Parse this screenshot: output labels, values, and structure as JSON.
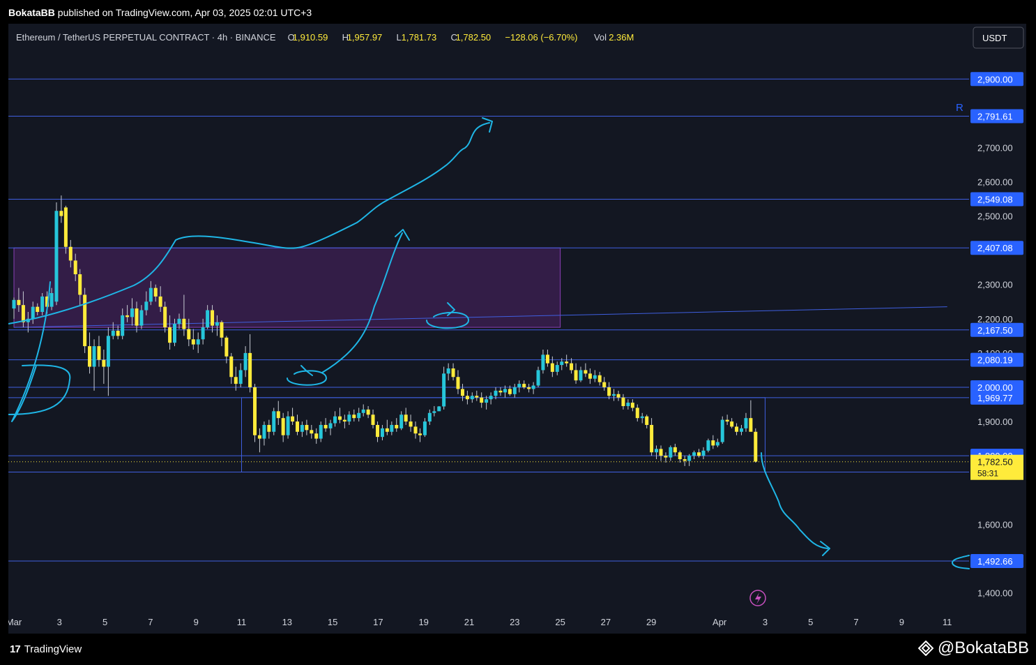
{
  "publish_bar": {
    "author": "BokataBB",
    "text": "published on TradingView.com, Apr 03, 2025 02:01 UTC+3"
  },
  "footer": {
    "logo_text": "TradingView",
    "watermark": "@BokataBB"
  },
  "colors": {
    "background": "#131722",
    "up": "#26c6da",
    "down": "#ffeb3b",
    "level_line": "#3f5fe0",
    "drawing": "#1fb6e6",
    "zone_fill": "#3a1f4d",
    "zone_stroke": "#8a3fb4",
    "label_bg": "#2962ff"
  },
  "chart_data": {
    "type": "candlestick",
    "legend": {
      "symbol": "Ethereum / TetherUS PERPETUAL CONTRACT · 4h · BINANCE",
      "open_label": "O",
      "open": "1,910.59",
      "high_label": "H",
      "high": "1,957.97",
      "low_label": "L",
      "low": "1,781.73",
      "close_label": "C",
      "close": "1,782.50",
      "change": "−128.06 (−6.70%)",
      "vol_label": "Vol",
      "vol": "2.36M"
    },
    "currency_button": "USDT",
    "right_marker": "R",
    "ylim": [
      1350,
      2980
    ],
    "x_day_range": [
      1,
      42
    ],
    "x_ticks": [
      {
        "day": 1,
        "label": "Mar"
      },
      {
        "day": 3,
        "label": "3"
      },
      {
        "day": 5,
        "label": "5"
      },
      {
        "day": 7,
        "label": "7"
      },
      {
        "day": 9,
        "label": "9"
      },
      {
        "day": 11,
        "label": "11"
      },
      {
        "day": 13,
        "label": "13"
      },
      {
        "day": 15,
        "label": "15"
      },
      {
        "day": 17,
        "label": "17"
      },
      {
        "day": 19,
        "label": "19"
      },
      {
        "day": 21,
        "label": "21"
      },
      {
        "day": 23,
        "label": "23"
      },
      {
        "day": 25,
        "label": "25"
      },
      {
        "day": 27,
        "label": "27"
      },
      {
        "day": 29,
        "label": "29"
      },
      {
        "day": 32,
        "label": "Apr"
      },
      {
        "day": 34,
        "label": "3"
      },
      {
        "day": 36,
        "label": "5"
      },
      {
        "day": 38,
        "label": "7"
      },
      {
        "day": 40,
        "label": "9"
      },
      {
        "day": 42,
        "label": "11"
      }
    ],
    "y_ticks": [
      {
        "value": 2700,
        "label": "2,700.00"
      },
      {
        "value": 2600,
        "label": "2,600.00"
      },
      {
        "value": 2500,
        "label": "2,500.00"
      },
      {
        "value": 2300,
        "label": "2,300.00"
      },
      {
        "value": 2200,
        "label": "2,200.00"
      },
      {
        "value": 2100,
        "label": "2,100.00"
      },
      {
        "value": 1900,
        "label": "1,900.00"
      },
      {
        "value": 1600,
        "label": "1,600.00"
      },
      {
        "value": 1400,
        "label": "1,400.00"
      }
    ],
    "levels": [
      {
        "value": 2900,
        "label": "2,900.00"
      },
      {
        "value": 2791.61,
        "label": "2,791.61"
      },
      {
        "value": 2549.08,
        "label": "2,549.08"
      },
      {
        "value": 2407.08,
        "label": "2,407.08"
      },
      {
        "value": 2167.5,
        "label": "2,167.50"
      },
      {
        "value": 2080.19,
        "label": "2,080.19"
      },
      {
        "value": 2000,
        "label": "2,000.00"
      },
      {
        "value": 1969.77,
        "label": "1,969.77"
      },
      {
        "value": 1800,
        "label": "1,800.00"
      },
      {
        "value": 1752.5,
        "label": "1,752.50"
      },
      {
        "value": 1492.66,
        "label": "1,492.66"
      }
    ],
    "current_price": {
      "value": 1782.5,
      "label": "1,782.50",
      "countdown": "58:31"
    },
    "zone": {
      "day_start": 1,
      "day_end": 25,
      "price_low": 2175,
      "price_high": 2407
    },
    "range_box": {
      "day_start": 11,
      "day_end": 34,
      "price_low": 1752.5,
      "price_high": 1969.77
    },
    "trendline": {
      "day_start": 1,
      "price_start": 2175,
      "day_end": 42,
      "price_end": 2235
    },
    "candles": [
      [
        1.0,
        2230,
        2262,
        2200,
        2255
      ],
      [
        1.17,
        2255,
        2290,
        2220,
        2240
      ],
      [
        1.33,
        2240,
        2280,
        2175,
        2190
      ],
      [
        1.5,
        2190,
        2220,
        2160,
        2200
      ],
      [
        1.67,
        2200,
        2250,
        2185,
        2235
      ],
      [
        1.83,
        2235,
        2245,
        2210,
        2220
      ],
      [
        2.0,
        2220,
        2275,
        2210,
        2265
      ],
      [
        2.17,
        2265,
        2280,
        2215,
        2235
      ],
      [
        2.33,
        2235,
        2290,
        2225,
        2275
      ],
      [
        2.5,
        2250,
        2540,
        2240,
        2515
      ],
      [
        2.67,
        2515,
        2560,
        2480,
        2500
      ],
      [
        2.83,
        2525,
        2530,
        2390,
        2410
      ],
      [
        3.0,
        2410,
        2430,
        2350,
        2370
      ],
      [
        3.17,
        2370,
        2390,
        2310,
        2330
      ],
      [
        3.33,
        2330,
        2345,
        2240,
        2270
      ],
      [
        3.5,
        2270,
        2290,
        2100,
        2120
      ],
      [
        3.67,
        2120,
        2160,
        2040,
        2060
      ],
      [
        3.83,
        2060,
        2140,
        1990,
        2120
      ],
      [
        4.0,
        2120,
        2150,
        2060,
        2080
      ],
      [
        4.17,
        2080,
        2110,
        2010,
        2060
      ],
      [
        4.33,
        2060,
        2175,
        1975,
        2150
      ],
      [
        4.5,
        2150,
        2190,
        2140,
        2165
      ],
      [
        4.67,
        2165,
        2180,
        2140,
        2150
      ],
      [
        4.83,
        2150,
        2230,
        2140,
        2210
      ],
      [
        5.0,
        2210,
        2240,
        2190,
        2205
      ],
      [
        5.17,
        2205,
        2260,
        2180,
        2230
      ],
      [
        5.33,
        2230,
        2250,
        2160,
        2180
      ],
      [
        5.5,
        2180,
        2240,
        2170,
        2225
      ],
      [
        5.67,
        2225,
        2280,
        2210,
        2250
      ],
      [
        5.83,
        2250,
        2310,
        2240,
        2290
      ],
      [
        6.0,
        2290,
        2300,
        2250,
        2265
      ],
      [
        6.17,
        2265,
        2295,
        2220,
        2235
      ],
      [
        6.33,
        2235,
        2250,
        2160,
        2175
      ],
      [
        6.5,
        2175,
        2210,
        2110,
        2130
      ],
      [
        6.67,
        2130,
        2200,
        2120,
        2185
      ],
      [
        6.83,
        2185,
        2215,
        2170,
        2200
      ],
      [
        7.0,
        2200,
        2270,
        2150,
        2170
      ],
      [
        7.17,
        2170,
        2200,
        2120,
        2140
      ],
      [
        7.33,
        2140,
        2170,
        2110,
        2125
      ],
      [
        7.5,
        2125,
        2160,
        2100,
        2140
      ],
      [
        7.67,
        2140,
        2200,
        2125,
        2175
      ],
      [
        7.83,
        2175,
        2240,
        2170,
        2225
      ],
      [
        8.0,
        2225,
        2240,
        2160,
        2180
      ],
      [
        8.17,
        2180,
        2210,
        2150,
        2190
      ],
      [
        8.33,
        2190,
        2195,
        2120,
        2145
      ],
      [
        8.5,
        2145,
        2150,
        2070,
        2090
      ],
      [
        8.67,
        2090,
        2100,
        2010,
        2030
      ],
      [
        8.83,
        2030,
        2060,
        1990,
        2010
      ],
      [
        9.0,
        2010,
        2070,
        2000,
        2050
      ],
      [
        9.17,
        2050,
        2120,
        2030,
        2100
      ],
      [
        9.33,
        2100,
        2155,
        1985,
        2000
      ],
      [
        9.5,
        2000,
        2010,
        1840,
        1860
      ],
      [
        9.67,
        1860,
        1880,
        1810,
        1850
      ],
      [
        9.83,
        1850,
        1900,
        1830,
        1890
      ],
      [
        10.0,
        1890,
        1905,
        1850,
        1870
      ],
      [
        10.17,
        1870,
        1940,
        1860,
        1930
      ],
      [
        10.33,
        1930,
        1960,
        1890,
        1910
      ],
      [
        10.5,
        1910,
        1925,
        1840,
        1860
      ],
      [
        10.67,
        1860,
        1930,
        1850,
        1915
      ],
      [
        10.83,
        1915,
        1940,
        1890,
        1900
      ],
      [
        11.0,
        1900,
        1920,
        1860,
        1870
      ],
      [
        11.17,
        1870,
        1900,
        1855,
        1890
      ],
      [
        11.33,
        1890,
        1905,
        1860,
        1875
      ],
      [
        11.5,
        1875,
        1890,
        1850,
        1865
      ],
      [
        11.67,
        1865,
        1880,
        1835,
        1850
      ],
      [
        11.83,
        1850,
        1900,
        1840,
        1890
      ],
      [
        12.0,
        1890,
        1910,
        1870,
        1880
      ],
      [
        12.17,
        1880,
        1905,
        1860,
        1895
      ],
      [
        12.33,
        1895,
        1930,
        1885,
        1915
      ],
      [
        12.5,
        1915,
        1940,
        1895,
        1905
      ],
      [
        12.67,
        1905,
        1920,
        1880,
        1900
      ],
      [
        12.83,
        1900,
        1930,
        1890,
        1920
      ],
      [
        13.0,
        1920,
        1935,
        1900,
        1910
      ],
      [
        13.17,
        1910,
        1940,
        1900,
        1925
      ],
      [
        13.33,
        1925,
        1950,
        1915,
        1935
      ],
      [
        13.5,
        1935,
        1945,
        1910,
        1920
      ],
      [
        13.67,
        1920,
        1935,
        1880,
        1890
      ],
      [
        13.83,
        1890,
        1900,
        1840,
        1855
      ],
      [
        14.0,
        1855,
        1890,
        1845,
        1880
      ],
      [
        14.17,
        1880,
        1905,
        1860,
        1870
      ],
      [
        14.33,
        1870,
        1900,
        1860,
        1890
      ],
      [
        14.5,
        1890,
        1910,
        1870,
        1880
      ],
      [
        14.67,
        1880,
        1930,
        1875,
        1920
      ],
      [
        14.83,
        1920,
        1940,
        1890,
        1900
      ],
      [
        15.0,
        1900,
        1920,
        1870,
        1885
      ],
      [
        15.17,
        1885,
        1900,
        1850,
        1865
      ],
      [
        15.33,
        1865,
        1880,
        1840,
        1860
      ],
      [
        15.5,
        1860,
        1910,
        1855,
        1900
      ],
      [
        15.67,
        1900,
        1935,
        1890,
        1925
      ],
      [
        15.83,
        1925,
        1945,
        1915,
        1930
      ],
      [
        16.0,
        1930,
        1945,
        1940,
        1944
      ],
      [
        16.17,
        1944,
        2060,
        1935,
        2040
      ],
      [
        16.33,
        2040,
        2070,
        2020,
        2055
      ],
      [
        16.5,
        2055,
        2070,
        2020,
        2030
      ],
      [
        16.67,
        2030,
        2050,
        1980,
        1995
      ],
      [
        16.83,
        1995,
        2010,
        1960,
        1975
      ],
      [
        17.0,
        1975,
        1990,
        1950,
        1965
      ],
      [
        17.17,
        1965,
        1985,
        1955,
        1975
      ],
      [
        17.33,
        1975,
        1990,
        1960,
        1970
      ],
      [
        17.5,
        1970,
        1985,
        1940,
        1955
      ],
      [
        17.67,
        1955,
        1975,
        1935,
        1965
      ],
      [
        17.83,
        1965,
        1985,
        1950,
        1975
      ],
      [
        18.0,
        1975,
        2000,
        1965,
        1990
      ],
      [
        18.17,
        1990,
        2000,
        1975,
        1985
      ],
      [
        18.33,
        1985,
        2005,
        1970,
        1995
      ],
      [
        18.5,
        1995,
        2005,
        1975,
        1980
      ],
      [
        18.67,
        1980,
        2010,
        1970,
        2000
      ],
      [
        18.83,
        2000,
        2020,
        1985,
        2010
      ],
      [
        19.0,
        2010,
        2020,
        1995,
        2000
      ],
      [
        19.17,
        2000,
        2010,
        1985,
        1995
      ],
      [
        19.33,
        1995,
        2015,
        1980,
        2005
      ],
      [
        19.5,
        2005,
        2060,
        2000,
        2050
      ],
      [
        19.67,
        2050,
        2110,
        2040,
        2095
      ],
      [
        19.83,
        2095,
        2110,
        2060,
        2070
      ],
      [
        20.0,
        2070,
        2090,
        2030,
        2045
      ],
      [
        20.17,
        2045,
        2075,
        2035,
        2065
      ],
      [
        20.33,
        2065,
        2085,
        2050,
        2075
      ],
      [
        20.5,
        2075,
        2095,
        2060,
        2070
      ],
      [
        20.67,
        2070,
        2085,
        2040,
        2050
      ],
      [
        20.83,
        2050,
        2070,
        2010,
        2020
      ],
      [
        21.0,
        2020,
        2060,
        2015,
        2050
      ],
      [
        21.17,
        2050,
        2070,
        2030,
        2040
      ],
      [
        21.33,
        2040,
        2055,
        2010,
        2025
      ],
      [
        21.5,
        2025,
        2050,
        2015,
        2035
      ],
      [
        21.67,
        2035,
        2045,
        2005,
        2015
      ],
      [
        21.83,
        2015,
        2030,
        1990,
        2000
      ],
      [
        22.0,
        2000,
        2015,
        1965,
        1975
      ],
      [
        22.17,
        1975,
        1995,
        1960,
        1980
      ],
      [
        22.33,
        1980,
        1990,
        1960,
        1970
      ],
      [
        22.5,
        1970,
        1980,
        1935,
        1945
      ],
      [
        22.67,
        1945,
        1965,
        1935,
        1955
      ],
      [
        22.83,
        1955,
        1965,
        1930,
        1940
      ],
      [
        23.0,
        1940,
        1950,
        1900,
        1910
      ],
      [
        23.17,
        1910,
        1925,
        1895,
        1915
      ],
      [
        23.33,
        1915,
        1920,
        1880,
        1890
      ],
      [
        23.5,
        1890,
        1910,
        1800,
        1810
      ],
      [
        23.67,
        1810,
        1830,
        1790,
        1820
      ],
      [
        23.83,
        1820,
        1830,
        1785,
        1800
      ],
      [
        24.0,
        1800,
        1810,
        1780,
        1795
      ],
      [
        24.17,
        1795,
        1830,
        1785,
        1825
      ],
      [
        24.33,
        1825,
        1835,
        1800,
        1810
      ],
      [
        24.5,
        1810,
        1815,
        1780,
        1790
      ],
      [
        24.67,
        1790,
        1800,
        1770,
        1785
      ],
      [
        24.83,
        1785,
        1805,
        1770,
        1800
      ],
      [
        25.0,
        1800,
        1815,
        1790,
        1810
      ],
      [
        25.17,
        1810,
        1820,
        1795,
        1800
      ],
      [
        25.33,
        1800,
        1825,
        1790,
        1815
      ],
      [
        25.5,
        1815,
        1850,
        1810,
        1845
      ],
      [
        25.67,
        1845,
        1860,
        1820,
        1830
      ],
      [
        25.83,
        1830,
        1850,
        1825,
        1840
      ],
      [
        26.0,
        1840,
        1915,
        1835,
        1905
      ],
      [
        26.17,
        1905,
        1920,
        1890,
        1900
      ],
      [
        26.33,
        1900,
        1910,
        1880,
        1885
      ],
      [
        26.5,
        1885,
        1895,
        1860,
        1870
      ],
      [
        26.67,
        1870,
        1890,
        1860,
        1880
      ],
      [
        26.83,
        1880,
        1925,
        1870,
        1910
      ],
      [
        27.0,
        1910,
        1962,
        1900,
        1870
      ],
      [
        27.17,
        1870,
        1880,
        1780,
        1783
      ]
    ],
    "icon_name": "lightning-icon"
  }
}
